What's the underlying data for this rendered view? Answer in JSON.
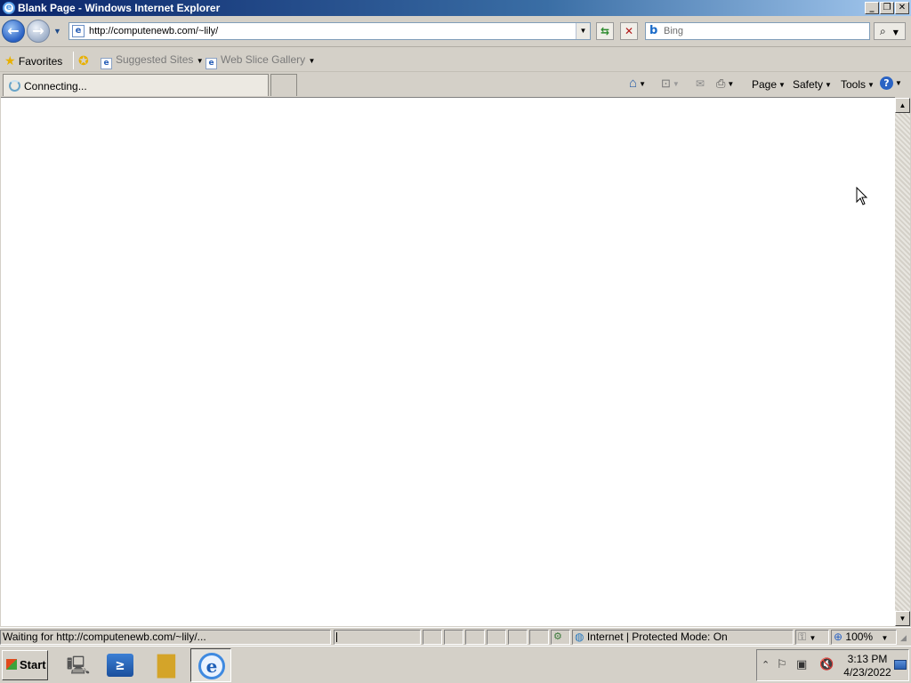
{
  "window": {
    "title": "Blank Page - Windows Internet Explorer",
    "minimize": "_",
    "restore": "❐",
    "close": "✕"
  },
  "nav": {
    "back_icon": "back-arrow-icon",
    "forward_icon": "forward-arrow-icon",
    "address": "http://computenewb.com/~lily/",
    "search_placeholder": "Bing"
  },
  "favorites_bar": {
    "favorites": "Favorites",
    "suggested_sites": "Suggested Sites",
    "web_slice_gallery": "Web Slice Gallery"
  },
  "tab": {
    "label": "Connecting..."
  },
  "command_bar": {
    "page": "Page",
    "safety": "Safety",
    "tools": "Tools",
    "help_icon": "help-icon"
  },
  "status_bar": {
    "message": "Waiting for http://computenewb.com/~lily/...",
    "zone": "Internet | Protected Mode: On",
    "zoom": "100%"
  },
  "taskbar": {
    "start": "Start",
    "time": "3:13 PM",
    "date": "4/23/2022"
  },
  "colors": {
    "title_gradient_start": "#0a246a",
    "chrome": "#d4d0c8"
  }
}
